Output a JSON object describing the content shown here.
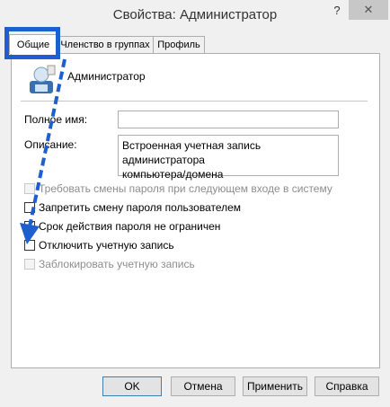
{
  "window": {
    "title": "Свойства: Администратор",
    "help": "?",
    "close": "✕"
  },
  "tabs": [
    {
      "label": "Общие",
      "active": true
    },
    {
      "label": "Членство в группах",
      "active": false
    },
    {
      "label": "Профиль",
      "active": false
    }
  ],
  "user": {
    "name": "Администратор",
    "icon": "user-icon"
  },
  "fields": {
    "full_name": {
      "label": "Полное имя:",
      "value": ""
    },
    "description": {
      "label": "Описание:",
      "value": "Встроенная учетная запись администратора\nкомпьютера/домена"
    }
  },
  "checkboxes": [
    {
      "label": "Требовать смены пароля при следующем входе в систему",
      "checked": false,
      "enabled": false
    },
    {
      "label": "Запретить смену пароля пользователем",
      "checked": false,
      "enabled": true
    },
    {
      "label": "Срок действия пароля не ограничен",
      "checked": true,
      "enabled": true
    },
    {
      "label": "Отключить учетную запись",
      "checked": false,
      "enabled": true
    },
    {
      "label": "Заблокировать учетную запись",
      "checked": false,
      "enabled": false
    }
  ],
  "buttons": {
    "ok": "OK",
    "cancel": "Отмена",
    "apply": "Применить",
    "help": "Справка"
  },
  "annotation": {
    "highlight_color": "#1e5fd0",
    "arrow_color": "#1e5fd0"
  }
}
